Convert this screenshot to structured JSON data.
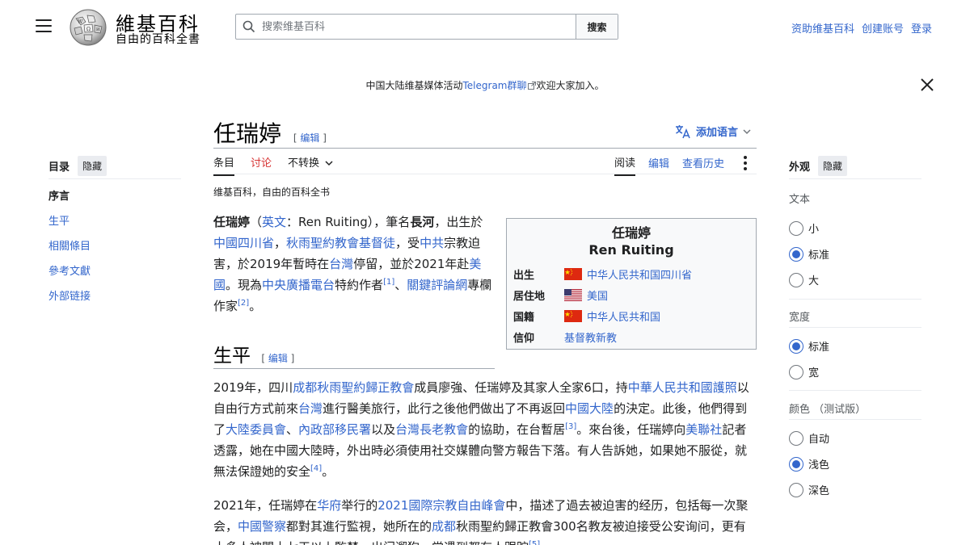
{
  "header": {
    "logo_title": "維基百科",
    "logo_subtitle": "自由的百科全書",
    "search_placeholder": "搜索维基百科",
    "search_button": "搜索",
    "user_links": [
      "资助维基百科",
      "创建账号",
      "登录"
    ]
  },
  "banner": {
    "text_before": "中国大陆维基媒体活动",
    "link": "Telegram群聊",
    "text_after": "欢迎大家加入。"
  },
  "toc": {
    "title": "目录",
    "hide": "隐藏",
    "items": [
      "序言",
      "生平",
      "相關條目",
      "參考文獻",
      "外部链接"
    ]
  },
  "appearance": {
    "title": "外观",
    "hide": "隐藏",
    "text_label": "文本",
    "text_options": [
      "小",
      "标准",
      "大"
    ],
    "text_selected": "标准",
    "width_label": "宽度",
    "width_options": [
      "标准",
      "宽"
    ],
    "width_selected": "标准",
    "color_label": "颜色 （测试版）",
    "color_options": [
      "自动",
      "浅色",
      "深色"
    ],
    "color_selected": "浅色"
  },
  "article": {
    "title": "任瑞婷",
    "edit": "编辑",
    "add_languages": "添加语言",
    "tabs_left": [
      "条目",
      "讨论",
      "不转换"
    ],
    "tabs_right": [
      "阅读",
      "编辑",
      "查看历史"
    ],
    "tagline": "维基百科，自由的百科全书",
    "section_title": "生平",
    "section_edit": "编辑"
  },
  "infobox": {
    "name_zh": "任瑞婷",
    "name_en": "Ren Ruiting",
    "rows": [
      {
        "label": "出生",
        "value": "中华人民共和国四川省",
        "flag": "cn"
      },
      {
        "label": "居住地",
        "value": "美国",
        "flag": "us"
      },
      {
        "label": "国籍",
        "value": "中华人民共和国",
        "flag": "cn"
      },
      {
        "label": "信仰",
        "value": "基督教新教",
        "flag": ""
      }
    ]
  },
  "colors": {
    "link": "#3366cc",
    "red_link": "#d73333",
    "accent_radio": "#3366cc"
  }
}
